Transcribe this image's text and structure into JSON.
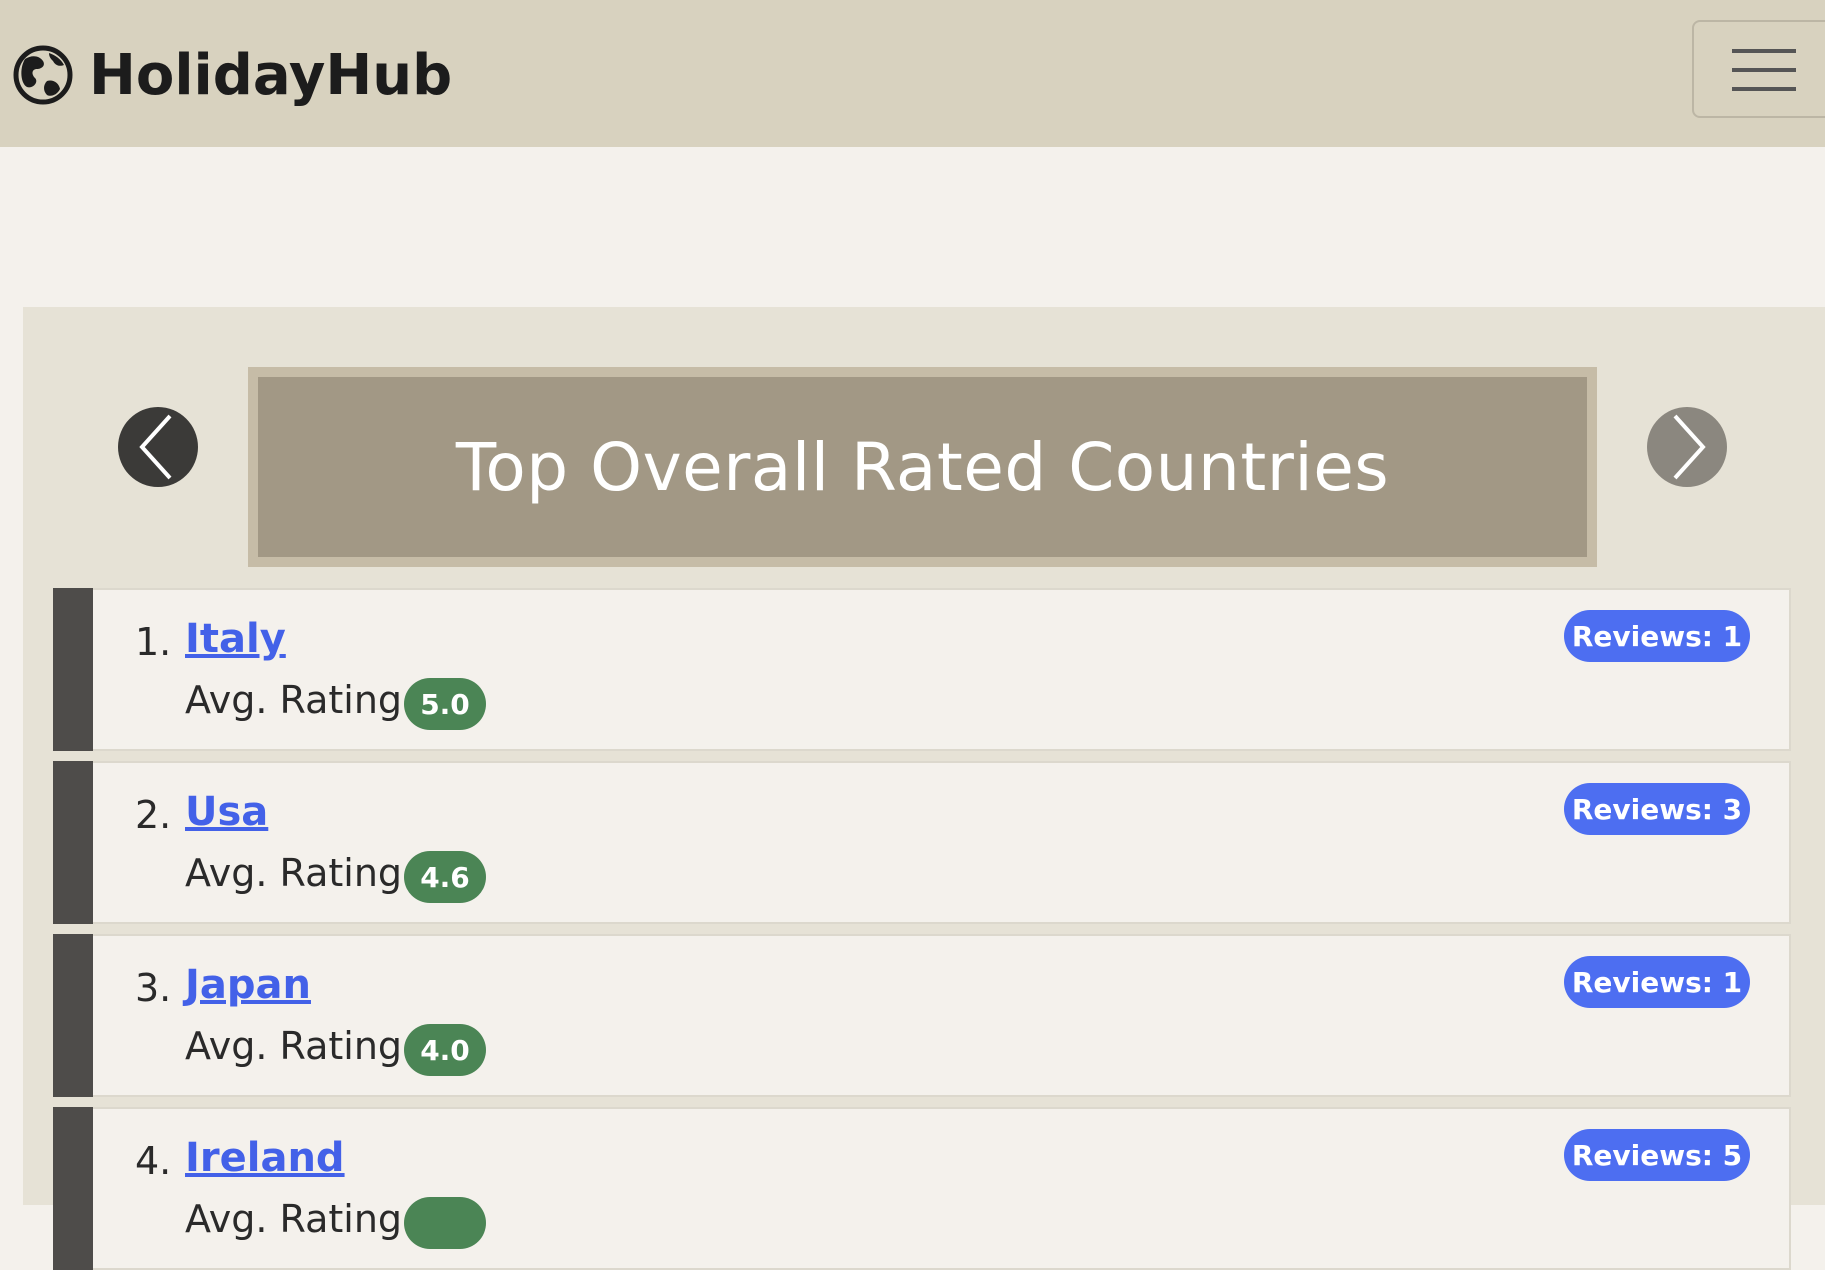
{
  "header": {
    "brand": "HolidayHub",
    "brand_icon": "globe-icon",
    "menu_icon": "hamburger-menu-icon"
  },
  "carousel": {
    "title": "Top Overall Rated Countries",
    "prev_icon": "chevron-left-icon",
    "next_icon": "chevron-right-icon"
  },
  "ranking": [
    {
      "rank": "1.",
      "country": "Italy",
      "rating_label": "Avg. Rating:",
      "rating": "5.0",
      "reviews": "Reviews: 1"
    },
    {
      "rank": "2.",
      "country": "Usa",
      "rating_label": "Avg. Rating:",
      "rating": "4.6",
      "reviews": "Reviews: 3"
    },
    {
      "rank": "3.",
      "country": "Japan",
      "rating_label": "Avg. Rating:",
      "rating": "4.0",
      "reviews": "Reviews: 1"
    },
    {
      "rank": "4.",
      "country": "Ireland",
      "rating_label": "Avg. Rating:",
      "rating": "",
      "reviews": "Reviews: 5"
    }
  ],
  "colors": {
    "navbar": "#d8d2bf",
    "link": "#4361e8",
    "rating_badge": "#4b8555",
    "reviews_badge": "#4d6ef1",
    "banner": "#a29885"
  }
}
